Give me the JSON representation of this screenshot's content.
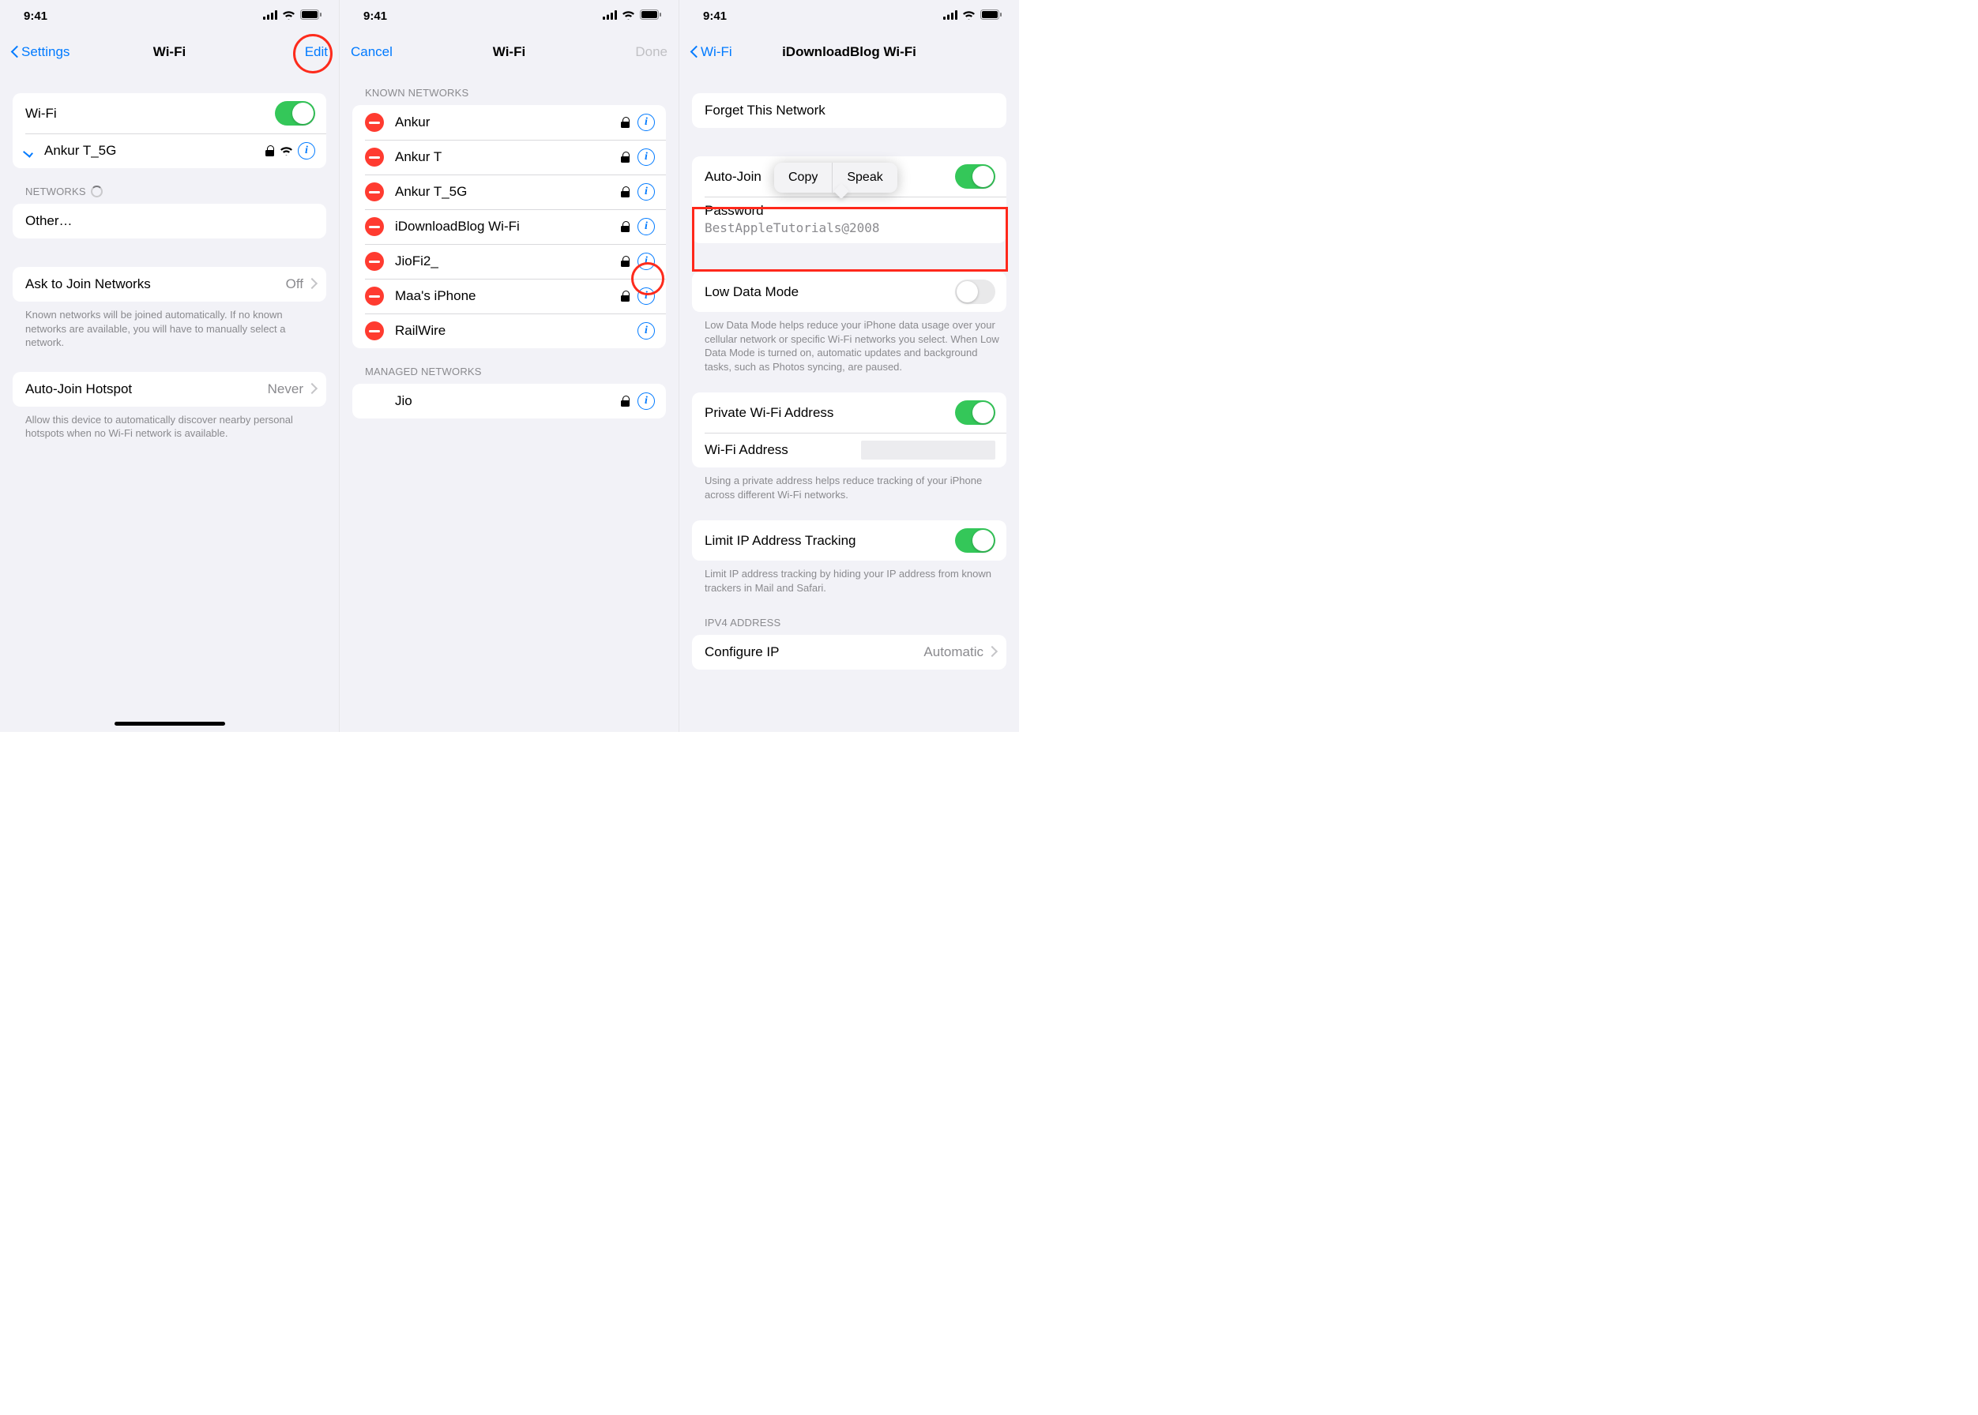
{
  "status": {
    "time": "9:41"
  },
  "panel1": {
    "back": "Settings",
    "title": "Wi-Fi",
    "edit": "Edit",
    "wifi_label": "Wi-Fi",
    "connected": "Ankur T_5G",
    "networks_header": "NETWORKS",
    "other": "Other…",
    "ask_label": "Ask to Join Networks",
    "ask_value": "Off",
    "ask_footer": "Known networks will be joined automatically. If no known networks are available, you will have to manually select a network.",
    "hotspot_label": "Auto-Join Hotspot",
    "hotspot_value": "Never",
    "hotspot_footer": "Allow this device to automatically discover nearby personal hotspots when no Wi-Fi network is available."
  },
  "panel2": {
    "cancel": "Cancel",
    "title": "Wi-Fi",
    "done": "Done",
    "known_header": "KNOWN NETWORKS",
    "known": [
      {
        "name": "Ankur",
        "lock": true
      },
      {
        "name": "Ankur T",
        "lock": true
      },
      {
        "name": "Ankur T_5G",
        "lock": true
      },
      {
        "name": "iDownloadBlog Wi-Fi",
        "lock": true
      },
      {
        "name": "JioFi2_",
        "lock": true
      },
      {
        "name": "Maa's iPhone",
        "lock": true
      },
      {
        "name": "RailWire",
        "lock": false
      }
    ],
    "managed_header": "MANAGED NETWORKS",
    "managed": [
      {
        "name": "Jio",
        "lock": true
      }
    ]
  },
  "panel3": {
    "back": "Wi-Fi",
    "title": "iDownloadBlog Wi-Fi",
    "forget": "Forget This Network",
    "autojoin": "Auto-Join",
    "password_label": "Password",
    "password_value": "BestAppleTutorials@2008",
    "popover": {
      "copy": "Copy",
      "speak": "Speak"
    },
    "lowdata": "Low Data Mode",
    "lowdata_footer": "Low Data Mode helps reduce your iPhone data usage over your cellular network or specific Wi-Fi networks you select. When Low Data Mode is turned on, automatic updates and background tasks, such as Photos syncing, are paused.",
    "private_addr": "Private Wi-Fi Address",
    "wifi_addr": "Wi-Fi Address",
    "private_footer": "Using a private address helps reduce tracking of your iPhone across different Wi-Fi networks.",
    "limit_ip": "Limit IP Address Tracking",
    "limit_footer": "Limit IP address tracking by hiding your IP address from known trackers in Mail and Safari.",
    "ipv4_header": "IPV4 ADDRESS",
    "configure_ip": "Configure IP",
    "configure_ip_value": "Automatic"
  }
}
